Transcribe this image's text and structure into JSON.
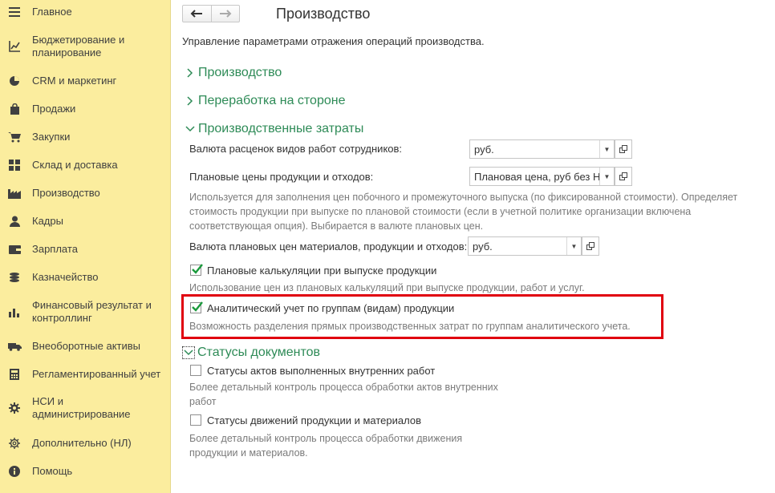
{
  "sidebar": {
    "items": [
      {
        "label": "Главное",
        "icon": "menu-icon"
      },
      {
        "label": "Бюджетирование и планирование",
        "icon": "budget-chart-icon"
      },
      {
        "label": "CRM и маркетинг",
        "icon": "pie-chart-icon"
      },
      {
        "label": "Продажи",
        "icon": "shopping-bag-icon"
      },
      {
        "label": "Закупки",
        "icon": "cart-icon"
      },
      {
        "label": "Склад и доставка",
        "icon": "warehouse-grid-icon"
      },
      {
        "label": "Производство",
        "icon": "factory-icon"
      },
      {
        "label": "Кадры",
        "icon": "person-icon"
      },
      {
        "label": "Зарплата",
        "icon": "wallet-icon"
      },
      {
        "label": "Казначейство",
        "icon": "coins-icon"
      },
      {
        "label": "Финансовый результат и контроллинг",
        "icon": "bar-chart-icon"
      },
      {
        "label": "Внеоборотные активы",
        "icon": "truck-icon"
      },
      {
        "label": "Регламентированный учет",
        "icon": "calculator-icon"
      },
      {
        "label": "НСИ и администрирование",
        "icon": "gear-icon"
      },
      {
        "label": "Дополнительно (НЛ)",
        "icon": "gear-outline-icon"
      },
      {
        "label": "Помощь",
        "icon": "info-icon"
      }
    ]
  },
  "header": {
    "back_glyph": "🡐",
    "forward_glyph": "🡒",
    "title": "Производство",
    "subtitle": "Управление параметрами отражения операций производства."
  },
  "sections": {
    "production": "Производство",
    "outsourcing": "Переработка на стороне",
    "costs": "Производственные затраты",
    "doc_statuses": "Статусы документов"
  },
  "costs": {
    "rates_currency_label": "Валюта расценок видов работ сотрудников:",
    "rates_currency_value": "руб.",
    "planned_prices_label": "Плановые цены продукции и отходов:",
    "planned_prices_value": "Плановая цена, руб без НДС",
    "planned_prices_hint": [
      "Используется для заполнения цен побочного и промежуточного выпуска (по фиксированной стоимости). Определяет",
      "стоимость продукции при выпуске по плановой стоимости (если в учетной политике организации включена",
      "соответствующая опция). Выбирается в валюте плановых цен."
    ],
    "planned_currency_label": "Валюта плановых цен материалов, продукции и отходов:",
    "planned_currency_value": "руб.",
    "planned_calc_label": "Плановые калькуляции при выпуске продукции",
    "planned_calc_checked": true,
    "planned_calc_hint": "Использование цен из плановых калькуляций при выпуске продукции, работ и услуг.",
    "analytic_label": "Аналитический учет по группам (видам) продукции",
    "analytic_checked": true,
    "analytic_hint": "Возможность разделения прямых производственных затрат по группам аналитического учета."
  },
  "statuses": {
    "acts_label": "Статусы актов выполненных внутренних работ",
    "acts_checked": false,
    "acts_hint": [
      "Более детальный контроль процесса обработки актов внутренних",
      "работ"
    ],
    "moves_label": "Статусы движений продукции и материалов",
    "moves_checked": false,
    "moves_hint": [
      "Более детальный контроль процесса обработки движения",
      "продукции и материалов."
    ]
  },
  "colors": {
    "sidebar_bg": "#fbed9e",
    "section_green": "#2e8b57",
    "highlight_red": "#e0000f"
  }
}
